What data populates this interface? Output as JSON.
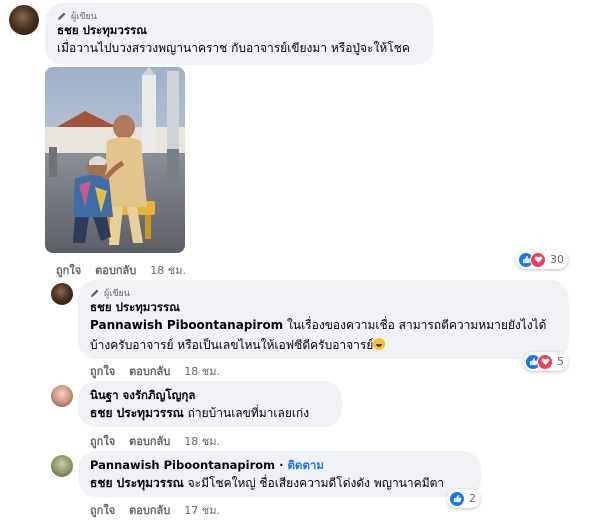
{
  "comments": [
    {
      "badge": "ผู้เขียน",
      "author": "ธชย ประทุมวรรณ",
      "text": "เมื่อวานไปบวงสรวงพญานาคราช กับอาจารย์เขียงมา หรือปู่จะให้โชค",
      "like_label": "ถูกใจ",
      "reply_label": "ตอบกลับ",
      "time": "18 ชม.",
      "reaction_count": "30"
    },
    {
      "badge": "ผู้เขียน",
      "author": "ธชย ประทุมวรรณ",
      "mention": "Pannawish Piboontanapirom",
      "text_line1": " ในเรื่องของความเชื่อ สามารถตีความหมายยังไงได้",
      "text_line2": "บ้างครับอาจารย์ หรือเป็นเลขไหนให้เอฟซีดีครับอาจารย์",
      "like_label": "ถูกใจ",
      "reply_label": "ตอบกลับ",
      "time": "18 ชม.",
      "reaction_count": "5"
    },
    {
      "author": "นินฐา จงรักภิญโญกุล",
      "mention": "ธชย ประทุมวรรณ",
      "text": " ถ่ายบ้านเลขที่มาเลยเก่ง",
      "like_label": "ถูกใจ",
      "reply_label": "ตอบกลับ",
      "time": "18 ชม."
    },
    {
      "author": "Pannawish Piboontanapirom",
      "follow_sep": " · ",
      "follow_label": "ติดตาม",
      "mention": "ธชย ประทุมวรรณ",
      "text": " จะมีโชคใหญ่ ชื่อเสียงความดีโด่งดัง พญานาคมีตา",
      "like_label": "ถูกใจ",
      "reply_label": "ตอบกลับ",
      "time": "17 ชม.",
      "reaction_count": "2"
    }
  ],
  "colors": {
    "bubble": "#f0f2f5",
    "link": "#1877f2",
    "muted": "#65676b",
    "like": "#1877f2",
    "love": "#f33e58",
    "haha": "#f7b125"
  }
}
